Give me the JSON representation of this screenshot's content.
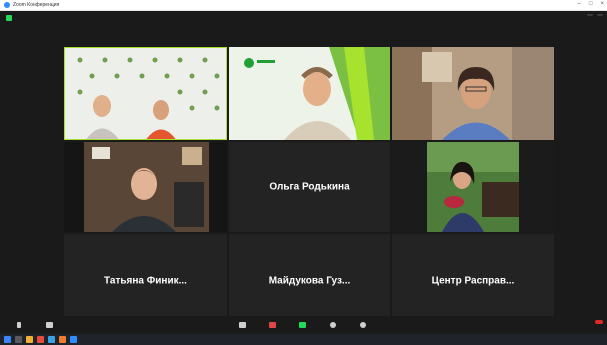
{
  "window": {
    "title": "Zoom Конференция"
  },
  "colors": {
    "active_speaker": "#a6e22e",
    "end_button": "#e02828",
    "security_green": "#23d959"
  },
  "tiles": [
    {
      "name": "",
      "big_name": ""
    },
    {
      "name": "",
      "big_name": ""
    },
    {
      "name": "",
      "big_name": ""
    },
    {
      "name": "",
      "big_name": ""
    },
    {
      "name": "",
      "big_name": "Ольга Родькина"
    },
    {
      "name": "",
      "big_name": ""
    },
    {
      "name": "",
      "big_name": "Татьяна Финик..."
    },
    {
      "name": "",
      "big_name": "Майдукова Гуз..."
    },
    {
      "name": "",
      "big_name": "Центр Расправ..."
    }
  ],
  "toolbar": {
    "end_label": ""
  },
  "icons": [
    "mic-icon",
    "video-icon",
    "participants-icon",
    "chat-icon",
    "share-screen-icon",
    "record-icon",
    "reactions-icon"
  ]
}
